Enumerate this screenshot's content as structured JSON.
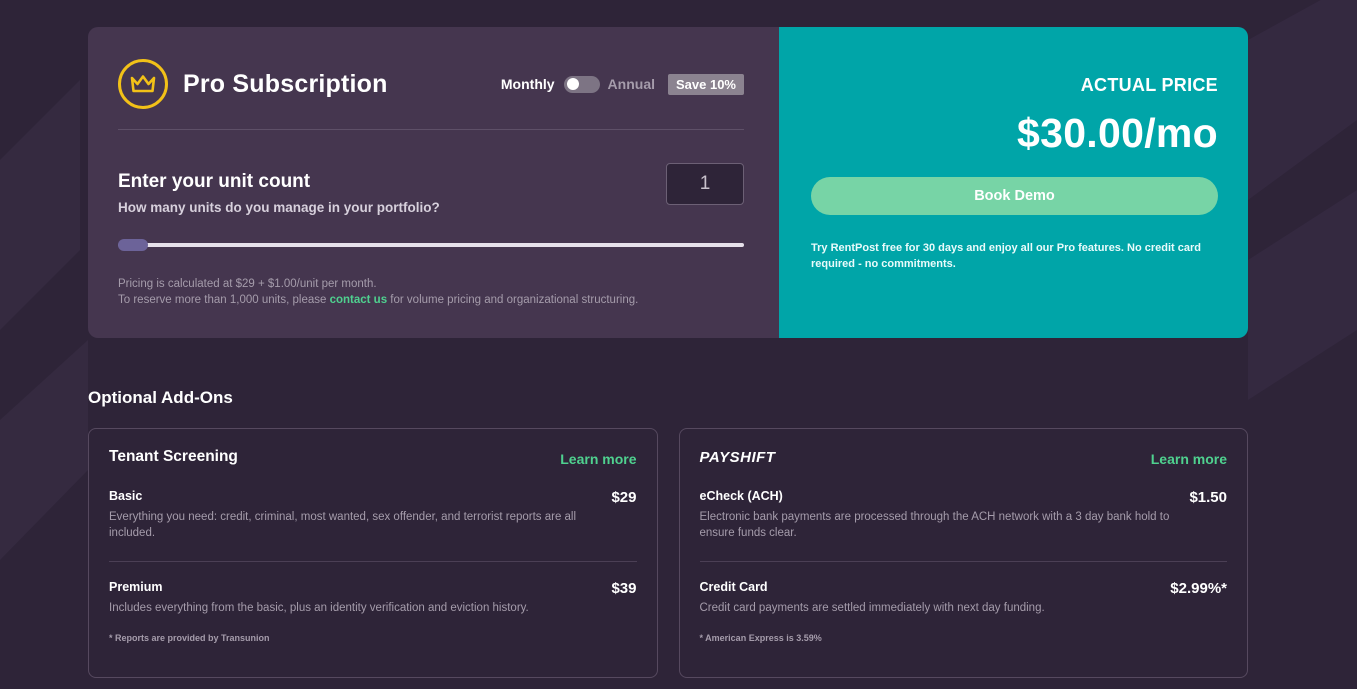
{
  "plan": {
    "title": "Pro Subscription",
    "icon": "crown-icon",
    "billing": {
      "monthly_label": "Monthly",
      "annual_label": "Annual",
      "save_badge": "Save 10%",
      "annual_enabled": false
    }
  },
  "units": {
    "heading": "Enter your unit count",
    "question": "How many units do you manage in your portfolio?",
    "value": "1",
    "slider_fraction": 0.0
  },
  "pricing_note": {
    "line1": "Pricing is calculated at $29 + $1.00/unit per month.",
    "line2_before": "To reserve more than 1,000 units, please ",
    "link_text": "contact us",
    "line2_after": " for volume pricing and organizational structuring."
  },
  "price_panel": {
    "label": "ACTUAL PRICE",
    "price": "$30.00/mo",
    "button_label": "Book Demo",
    "trial_text": "Try RentPost free for 30 days and enjoy all our Pro features. No credit card required - no commitments."
  },
  "addons": {
    "title": "Optional Add-Ons",
    "screening": {
      "title": "Tenant Screening",
      "learn_more": "Learn more",
      "items": [
        {
          "name": "Basic",
          "desc": "Everything you need:  credit, criminal, most wanted, sex offender, and terrorist reports are all included.",
          "price": "$29"
        },
        {
          "name": "Premium",
          "desc": "Includes everything from the basic, plus an identity verification and eviction history.",
          "price": "$39"
        }
      ],
      "footnote": "* Reports are provided by Transunion"
    },
    "payments": {
      "logo_text": "PAYSHIFT",
      "learn_more": "Learn more",
      "items": [
        {
          "name": "eCheck (ACH)",
          "desc": "Electronic bank payments are processed through the ACH network with a 3 day bank hold to ensure funds clear.",
          "price": "$1.50"
        },
        {
          "name": "Credit Card",
          "desc": "Credit card payments are settled immediately with next day funding.",
          "price": "$2.99%*"
        }
      ],
      "footnote": "* American Express is 3.59%"
    }
  },
  "colors": {
    "background": "#2e2438",
    "card": "#45364f",
    "teal": "#00a5a8",
    "accent_green": "#4fd18f",
    "button_green": "#77d4a6",
    "crown_yellow": "#f2c118"
  }
}
